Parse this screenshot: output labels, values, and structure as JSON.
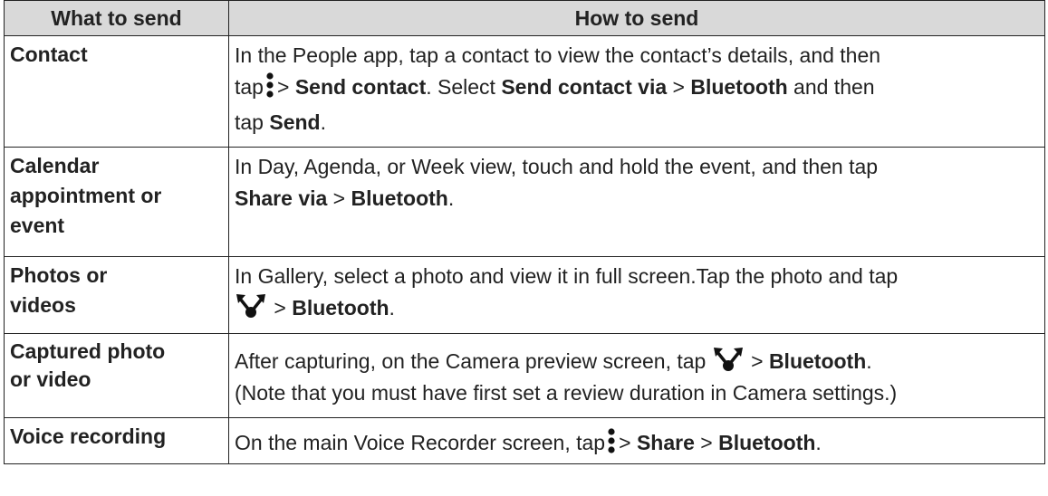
{
  "header": {
    "col1": "What to send",
    "col2": "How to send"
  },
  "rows": [
    {
      "what": "Contact",
      "how": [
        "In the People app, tap a contact to view the contact’s details, and then",
        "tap",
        "> ",
        "Send contact",
        ". Select ",
        "Send contact via",
        " > ",
        "Bluetooth",
        " and then",
        "tap ",
        "Send",
        "."
      ]
    },
    {
      "what": [
        "Calendar",
        "appointment or",
        "event"
      ],
      "how": [
        "In Day, Agenda, or Week view, touch and hold the event, and then tap",
        "Share via",
        " > ",
        "Bluetooth",
        "."
      ]
    },
    {
      "what": [
        "Photos or",
        "videos"
      ],
      "how": [
        "In Gallery, select a photo and view it in full screen.Tap the photo and tap",
        " > ",
        "Bluetooth",
        "."
      ]
    },
    {
      "what": [
        "Captured photo",
        "or video"
      ],
      "how": [
        "After capturing, on the Camera preview screen, tap ",
        " > ",
        "Bluetooth",
        ".",
        "(Note that you must have first set a review duration in Camera settings.)"
      ]
    },
    {
      "what": "Voice recording",
      "how": [
        "On the main Voice Recorder screen, tap",
        "> ",
        "Share",
        " > ",
        "Bluetooth",
        "."
      ]
    }
  ],
  "icons": {
    "menu": "menu-dots-icon",
    "share": "share-icon"
  },
  "colors": {
    "header_bg": "#d9d9d9",
    "text": "#222222",
    "border": "#222222"
  }
}
